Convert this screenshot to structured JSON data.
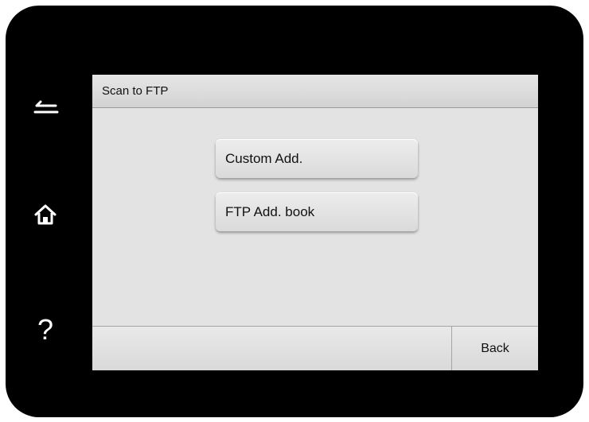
{
  "hardware_keys": {
    "back_icon": "back-arrow-icon",
    "home_icon": "home-icon",
    "help_label": "?"
  },
  "screen": {
    "title": "Scan to FTP",
    "menu": [
      {
        "label": "Custom Add."
      },
      {
        "label": "FTP Add. book"
      }
    ],
    "bottom_bar": {
      "back_label": "Back"
    }
  },
  "colors": {
    "bezel": "#000000",
    "screen_bg": "#e3e3e3",
    "bar_bg": "#d9d9d9",
    "text": "#111111"
  }
}
